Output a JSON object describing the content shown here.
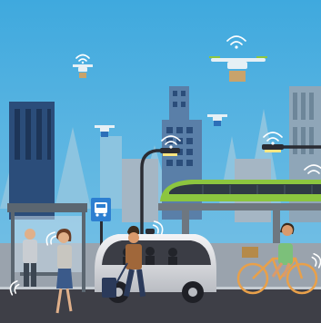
{
  "scene": {
    "description_type": "illustration",
    "elements": {
      "sky": "sky",
      "skyline": "city-skyline",
      "drones": [
        "drone-small-left",
        "drone-delivery-large",
        "drone-small-mid",
        "drone-small-right"
      ],
      "vehicles": [
        "autonomous-shuttle",
        "monorail-train"
      ],
      "people": [
        "person-waiting-at-stop",
        "woman-with-phone",
        "man-with-suitcase",
        "cyclist-with-basket"
      ],
      "infrastructure": [
        "bus-stop-shelter",
        "bus-stop-sign",
        "street-lamp-left",
        "street-lamp-right",
        "road",
        "sidewalk"
      ]
    },
    "bus_sign_icon": "bus-icon",
    "colors": {
      "sky": "#3fa9de",
      "skyline_far": "#8cc4e0",
      "building_dark": "#2b4d7a",
      "building_mid": "#5a7fa8",
      "building_gray": "#8fa6b8",
      "road": "#3e3f47",
      "sidewalk": "#9aa3ad",
      "shuttle_body": "#e8e8ea",
      "shuttle_window": "#3b3d45",
      "train_green": "#8cc63f",
      "bike_frame": "#e8a04a",
      "sign_blue": "#2d7fd1",
      "lamp_light": "#ffe680",
      "wifi": "#ffffff"
    }
  }
}
